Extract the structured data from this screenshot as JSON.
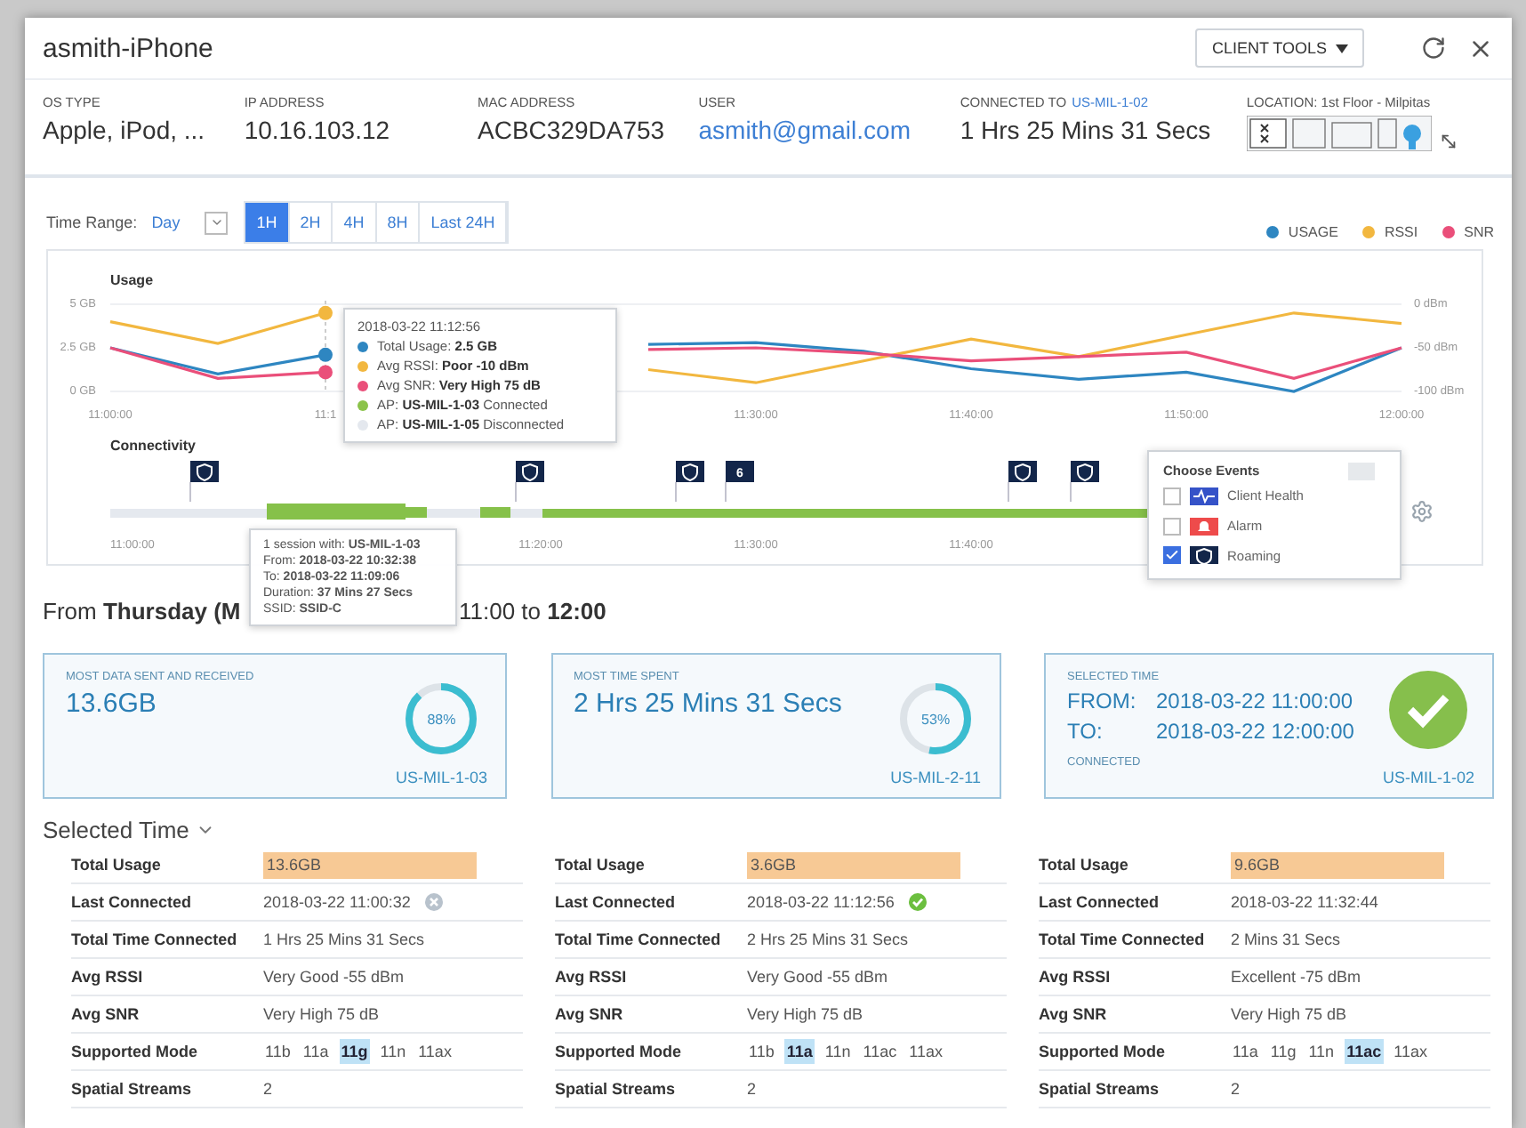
{
  "window": {
    "title": "asmith-iPhone",
    "client_tools": "CLIENT TOOLS"
  },
  "info": [
    {
      "label": "OS TYPE",
      "value": "Apple, iPod, ...",
      "kind": "text"
    },
    {
      "label": "IP ADDRESS",
      "value": "10.16.103.12",
      "kind": "text"
    },
    {
      "label": "MAC ADDRESS",
      "value": "ACBC329DA753",
      "kind": "text"
    },
    {
      "label": "USER",
      "value": "asmith@gmail.com",
      "kind": "link"
    },
    {
      "label": "CONNECTED TO",
      "link": "US-MIL-1-02",
      "value": "1 Hrs 25 Mins 31 Secs",
      "kind": "text"
    }
  ],
  "location": {
    "label": "LOCATION: 1st Floor - Milpitas"
  },
  "time_range": {
    "label": "Time Range:",
    "value": "Day",
    "options": [
      {
        "label": "1H",
        "selected": true
      },
      {
        "label": "2H",
        "selected": false
      },
      {
        "label": "4H",
        "selected": false
      },
      {
        "label": "8H",
        "selected": false
      },
      {
        "label": "Last 24H",
        "selected": false
      }
    ]
  },
  "usage_chart": {
    "title": "Usage",
    "chart_data": {
      "type": "line",
      "categories": [
        "11:00:00",
        null,
        "11:1",
        null,
        null,
        null,
        "11:30:00",
        null,
        "11:40:00",
        null,
        "11:50:00",
        null,
        "12:00:00"
      ],
      "ylim": [
        0,
        5
      ],
      "yticks": [
        {
          "value": 0,
          "label": "0 GB"
        },
        {
          "value": 2.5,
          "label": "2.5 GB"
        },
        {
          "value": 5,
          "label": "5 GB"
        }
      ],
      "y2lim": [
        -100,
        0
      ],
      "y2ticks": [
        {
          "value": 0,
          "label": "0 dBm"
        },
        {
          "value": -50,
          "label": "-50 dBm"
        },
        {
          "value": -100,
          "label": "-100 dBm"
        }
      ],
      "series": [
        {
          "name": "USAGE",
          "color": "#2e86c1",
          "values": [
            2.5,
            1.0,
            2.1,
            null,
            null,
            2.7,
            2.8,
            2.3,
            1.3,
            0.7,
            1.1,
            0.0,
            2.5
          ]
        },
        {
          "name": "RSSI",
          "color": "#f2b73f",
          "axis": "y2",
          "values": [
            -20,
            -45,
            -10,
            null,
            null,
            -75,
            -90,
            -65,
            -40,
            -60,
            -35,
            -10,
            -22
          ]
        },
        {
          "name": "SNR",
          "color": "#ea4f7a",
          "axis": "y2",
          "values": [
            -50,
            -85,
            -78,
            null,
            null,
            -52,
            -50,
            -56,
            -65,
            -60,
            -55,
            -85,
            -50
          ]
        }
      ]
    },
    "tooltip": {
      "time": "2018-03-22 11:12:56",
      "lines": [
        {
          "text": "Total Usage: **2.5 GB**",
          "color": "#2e86c1"
        },
        {
          "text": "Avg RSSI: **Poor -10 dBm**",
          "color": "#f2b73f"
        },
        {
          "text": "Avg SNR: **Very High 75 dB**",
          "color": "#ea4f7a"
        },
        {
          "text": "AP: **US-MIL-1-03** Connected",
          "color": "#8bc34a"
        },
        {
          "text": "AP: **US-MIL-1-05** Disconnected",
          "color": "#e4e8ee"
        }
      ]
    }
  },
  "connectivity": {
    "title": "Connectivity",
    "flags": [
      {
        "kind": "roaming"
      },
      {
        "kind": "roaming"
      },
      {
        "kind": "roaming"
      },
      {
        "kind": "count",
        "text": "6"
      },
      {
        "kind": "roaming"
      },
      {
        "kind": "roaming"
      }
    ],
    "time_labels": [
      "11:00:00",
      "11:20:00",
      "11:30:00",
      "11:40:00"
    ],
    "tooltip": {
      "lines": [
        "1 session with: **US-MIL-1-03**",
        "From: **2018-03-22 10:32:38**",
        "To: **2018-03-22 11:09:06**",
        "Duration: **37 Mins 27 Secs**",
        "SSID: **SSID-C**"
      ]
    }
  },
  "events": {
    "title": "Choose Events",
    "items": [
      {
        "label": "Client Health",
        "kind": "health",
        "checked": false,
        "color": "#3552c8"
      },
      {
        "label": "Alarm",
        "kind": "alarm",
        "checked": false,
        "color": "#ee4b4b"
      },
      {
        "label": "Roaming",
        "kind": "roaming",
        "checked": true,
        "color": "#13264a"
      }
    ]
  },
  "summary": {
    "heading_start": "From **Thursday (M**",
    "heading_end": "11:00 to **12:00**"
  },
  "cards": [
    {
      "kind": "donut",
      "label": "MOST DATA SENT AND RECEIVED",
      "value": "13.6GB",
      "percent": "88%",
      "level": 0.88,
      "ap": "US-MIL-1-03"
    },
    {
      "kind": "donut",
      "label": "MOST TIME SPENT",
      "value": "2 Hrs 25 Mins 31 Secs",
      "percent": "53%",
      "level": 0.53,
      "ap": "US-MIL-2-11"
    },
    {
      "kind": "time",
      "label": "SELECTED TIME",
      "rows": [
        {
          "label": "FROM:",
          "value": "2018-03-22 11:00:00"
        },
        {
          "label": "TO:",
          "value": "2018-03-22 12:00:00"
        }
      ],
      "status": "CONNECTED",
      "connected": true,
      "ap": "US-MIL-1-02"
    }
  ],
  "details": {
    "title": "Selected Time",
    "columns": [
      {
        "rows": [
          {
            "kind": "usage",
            "label": "Total Usage",
            "value": "13.6GB"
          },
          {
            "kind": "last",
            "label": "Last Connected",
            "value": "2018-03-22 11:00:32",
            "connected": false
          },
          {
            "kind": "text",
            "label": "Total Time Connected",
            "value": "1 Hrs 25 Mins 31 Secs"
          },
          {
            "kind": "text",
            "label": "Avg RSSI",
            "value": "Very Good -55 dBm"
          },
          {
            "kind": "text",
            "label": "Avg SNR",
            "value": "Very High 75 dB"
          },
          {
            "kind": "modes",
            "label": "Supported Mode",
            "modes": [
              {
                "label": "11b",
                "selected": false
              },
              {
                "label": "11a",
                "selected": false
              },
              {
                "label": "11g",
                "selected": true
              },
              {
                "label": "11n",
                "selected": false
              },
              {
                "label": "11ax",
                "selected": false
              }
            ]
          },
          {
            "kind": "text",
            "label": "Spatial Streams",
            "value": "2"
          }
        ]
      },
      {
        "rows": [
          {
            "kind": "usage",
            "label": "Total Usage",
            "value": "3.6GB"
          },
          {
            "kind": "last",
            "label": "Last Connected",
            "value": "2018-03-22 11:12:56",
            "connected": true
          },
          {
            "kind": "text",
            "label": "Total Time Connected",
            "value": "2 Hrs 25 Mins 31 Secs"
          },
          {
            "kind": "text",
            "label": "Avg RSSI",
            "value": "Very Good -55 dBm"
          },
          {
            "kind": "text",
            "label": "Avg SNR",
            "value": "Very High 75 dB"
          },
          {
            "kind": "modes",
            "label": "Supported Mode",
            "modes": [
              {
                "label": "11b",
                "selected": false
              },
              {
                "label": "11a",
                "selected": true
              },
              {
                "label": "11n",
                "selected": false
              },
              {
                "label": "11ac",
                "selected": false
              },
              {
                "label": "11ax",
                "selected": false
              }
            ]
          },
          {
            "kind": "text",
            "label": "Spatial Streams",
            "value": "2"
          }
        ]
      },
      {
        "rows": [
          {
            "kind": "usage",
            "label": "Total Usage",
            "value": "9.6GB"
          },
          {
            "kind": "text",
            "label": "Last Connected",
            "value": "2018-03-22 11:32:44"
          },
          {
            "kind": "text",
            "label": "Total Time Connected",
            "value": "2 Mins 31 Secs"
          },
          {
            "kind": "text",
            "label": "Avg RSSI",
            "value": "Excellent -75 dBm"
          },
          {
            "kind": "text",
            "label": "Avg SNR",
            "value": "Very High 75 dB"
          },
          {
            "kind": "modes",
            "label": "Supported Mode",
            "modes": [
              {
                "label": "11a",
                "selected": false
              },
              {
                "label": "11g",
                "selected": false
              },
              {
                "label": "11n",
                "selected": false
              },
              {
                "label": "11ac",
                "selected": true
              },
              {
                "label": "11ax",
                "selected": false
              }
            ]
          },
          {
            "kind": "text",
            "label": "Spatial Streams",
            "value": "2"
          }
        ]
      }
    ]
  }
}
